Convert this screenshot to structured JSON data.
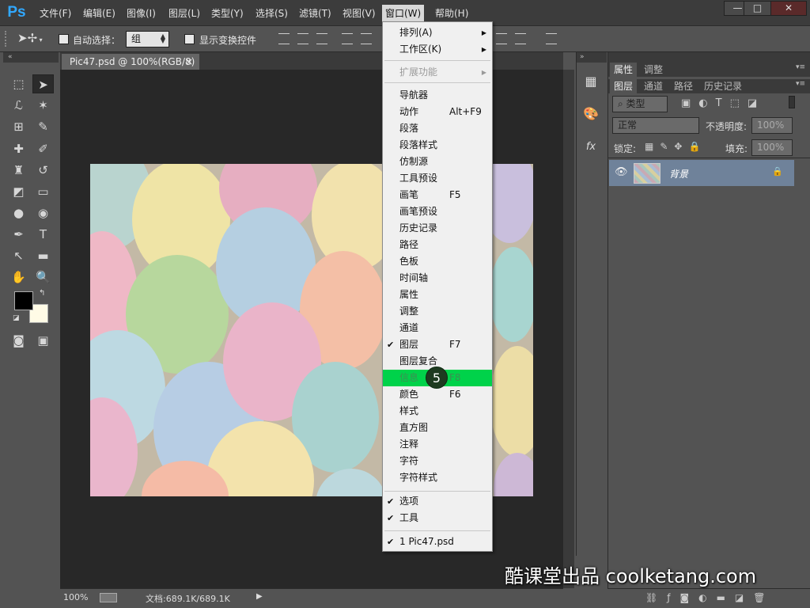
{
  "app": {
    "logo": "Ps"
  },
  "menubar": {
    "items": [
      "文件(F)",
      "编辑(E)",
      "图像(I)",
      "图层(L)",
      "类型(Y)",
      "选择(S)",
      "滤镜(T)",
      "视图(V)",
      "窗口(W)",
      "帮助(H)"
    ],
    "active": "窗口(W)"
  },
  "window_controls": {
    "minimize": "—",
    "maximize": "□",
    "close": "✕"
  },
  "options_bar": {
    "auto_select_label": "自动选择：",
    "auto_select_checked": false,
    "auto_select_value": "组",
    "transform_controls_label": "显示变换控件",
    "transform_controls_checked": false
  },
  "document": {
    "tab_title": "Pic47.psd @ 100%(RGB/8)",
    "tab_close": "×",
    "zoom": "100%",
    "doc_size": "文档:689.1K/689.1K"
  },
  "panels": {
    "top_tabs": [
      "属性",
      "调整"
    ],
    "layer_tabs": [
      "图层",
      "通道",
      "路径",
      "历史记录"
    ],
    "filter_label": "类型",
    "blend_mode": "正常",
    "opacity_label": "不透明度:",
    "opacity_value": "100%",
    "lock_label": "锁定:",
    "fill_label": "填充:",
    "fill_value": "100%",
    "layer_name": "背景"
  },
  "window_menu": {
    "group1": [
      {
        "label": "排列(A)",
        "submenu": true
      },
      {
        "label": "工作区(K)",
        "submenu": true
      }
    ],
    "group2": [
      {
        "label": "扩展功能",
        "submenu": true,
        "disabled": true
      }
    ],
    "group3": [
      {
        "label": "导航器"
      },
      {
        "label": "动作",
        "shortcut": "Alt+F9"
      },
      {
        "label": "段落"
      },
      {
        "label": "段落样式"
      },
      {
        "label": "仿制源"
      },
      {
        "label": "工具预设"
      },
      {
        "label": "画笔",
        "shortcut": "F5"
      },
      {
        "label": "画笔预设"
      },
      {
        "label": "历史记录"
      },
      {
        "label": "路径"
      },
      {
        "label": "色板"
      },
      {
        "label": "时间轴"
      },
      {
        "label": "属性"
      },
      {
        "label": "调整"
      },
      {
        "label": "通道"
      },
      {
        "label": "图层",
        "shortcut": "F7",
        "checked": true
      },
      {
        "label": "图层复合"
      },
      {
        "label": "信息",
        "shortcut": "F8",
        "highlighted": true
      },
      {
        "label": "颜色",
        "shortcut": "F6"
      },
      {
        "label": "样式"
      },
      {
        "label": "直方图"
      },
      {
        "label": "注释"
      },
      {
        "label": "字符"
      },
      {
        "label": "字符样式"
      }
    ],
    "group4": [
      {
        "label": "选项",
        "checked": true
      },
      {
        "label": "工具",
        "checked": true
      }
    ],
    "group5": [
      {
        "label": "1 Pic47.psd",
        "checked": true
      }
    ]
  },
  "step_badge": "5",
  "watermark": "酷课堂出品 coolketang.com",
  "colors": {
    "highlight": "#00d24a",
    "layer_selected": "#6f829a",
    "ps_logo": "#31a8ff"
  }
}
